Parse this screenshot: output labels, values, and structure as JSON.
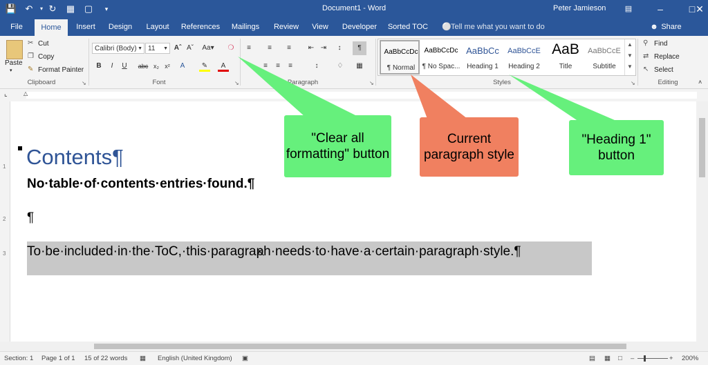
{
  "titlebar": {
    "document_title": "Document1 - Word",
    "user_name": "Peter Jamieson",
    "qat": {
      "save_icon": "save-icon",
      "undo_icon": "undo-icon",
      "redo_icon": "redo-icon"
    }
  },
  "tabs": [
    "File",
    "Home",
    "Insert",
    "Design",
    "Layout",
    "References",
    "Mailings",
    "Review",
    "View",
    "Developer",
    "Sorted TOC"
  ],
  "active_tab": "Home",
  "tell_me": "Tell me what you want to do",
  "share_label": "Share",
  "clipboard": {
    "paste": "Paste",
    "cut": "Cut",
    "copy": "Copy",
    "format_painter": "Format Painter",
    "group_label": "Clipboard"
  },
  "font": {
    "name": "Calibri (Body)",
    "size": "11",
    "group_label": "Font"
  },
  "paragraph_group_label": "Paragraph",
  "styles": {
    "items": [
      {
        "preview": "AaBbCcDc",
        "name": "¶ Normal"
      },
      {
        "preview": "AaBbCcDc",
        "name": "¶ No Spac..."
      },
      {
        "preview": "AaBbCc",
        "name": "Heading 1"
      },
      {
        "preview": "AaBbCcE",
        "name": "Heading 2"
      },
      {
        "preview": "AaB",
        "name": "Title"
      },
      {
        "preview": "AaBbCcE",
        "name": "Subtitle"
      }
    ],
    "group_label": "Styles"
  },
  "editing": {
    "find": "Find",
    "replace": "Replace",
    "select": "Select",
    "group_label": "Editing"
  },
  "document": {
    "heading": "Contents¶",
    "no_toc": "No·table·of·contents·entries·found.¶",
    "empty_para": "¶",
    "body_para": "To·be·included·in·the·ToC,·this·paragraph·needs·to·have·a·certain·paragraph·style.¶"
  },
  "callouts": {
    "clear_formatting": "\"Clear all formatting\" button",
    "current_style": "Current paragraph style",
    "heading1": "\"Heading 1\" button"
  },
  "colors": {
    "word_blue": "#2b579a",
    "heading_blue": "#2f5496",
    "callout_green": "#66f07c",
    "callout_orange": "#f08060"
  },
  "statusbar": {
    "section": "Section: 1",
    "page": "Page 1 of 1",
    "words": "15 of 22 words",
    "language": "English (United Kingdom)",
    "zoom": "200%"
  }
}
